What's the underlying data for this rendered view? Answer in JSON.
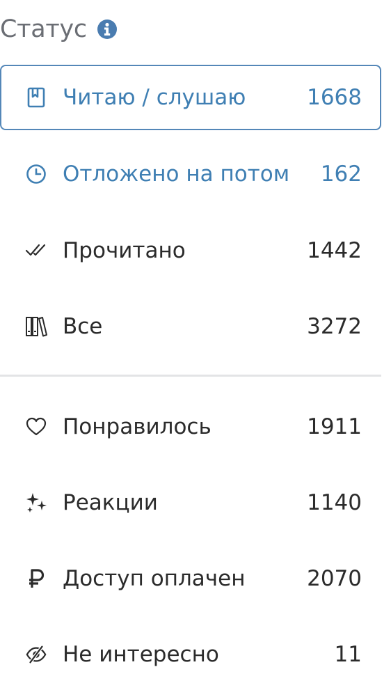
{
  "header": {
    "title": "Статус",
    "info_icon": "info-icon"
  },
  "colors": {
    "accent": "#3f7fb3",
    "border_active": "#5487b8",
    "text": "#2b2b2b",
    "muted": "#6b6e74",
    "divider": "#e3e4e6"
  },
  "status_items": [
    {
      "label": "Читаю / слушаю",
      "count": "1668",
      "icon": "bookmark-book-icon",
      "active": true
    },
    {
      "label": "Отложено на потом",
      "count": "162",
      "icon": "clock-icon",
      "active": false
    },
    {
      "label": "Прочитано",
      "count": "1442",
      "icon": "double-check-icon",
      "active": false
    },
    {
      "label": "Все",
      "count": "3272",
      "icon": "bookshelf-icon",
      "active": false
    }
  ],
  "extra_items": [
    {
      "label": "Понравилось",
      "count": "1911",
      "icon": "heart-icon"
    },
    {
      "label": "Реакции",
      "count": "1140",
      "icon": "sparkles-icon"
    },
    {
      "label": "Доступ оплачен",
      "count": "2070",
      "icon": "ruble-icon"
    },
    {
      "label": "Не интересно",
      "count": "11",
      "icon": "eye-slash-icon"
    }
  ]
}
